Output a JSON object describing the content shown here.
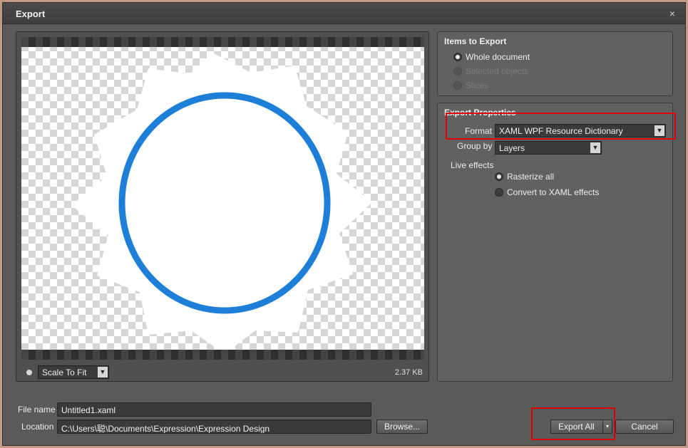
{
  "window": {
    "title": "Export",
    "close_glyph": "×"
  },
  "preview": {
    "zoom_value": "Scale To Fit",
    "file_size": "2.37 KB"
  },
  "items_to_export": {
    "title": "Items to Export",
    "options": [
      {
        "label": "Whole document",
        "checked": true,
        "enabled": true
      },
      {
        "label": "Selected objects",
        "checked": false,
        "enabled": false
      },
      {
        "label": "Slices",
        "checked": false,
        "enabled": false
      }
    ]
  },
  "export_properties": {
    "title": "Export Properties",
    "format_label": "Format",
    "format_value": "XAML WPF Resource Dictionary",
    "group_by_label": "Group by",
    "group_by_value": "Layers",
    "live_effects_label": "Live effects",
    "live_effects_options": [
      {
        "label": "Rasterize all",
        "checked": true
      },
      {
        "label": "Convert to XAML effects",
        "checked": false
      }
    ]
  },
  "file": {
    "name_label": "File name",
    "name_value": "Untitled1.xaml",
    "location_label": "Location",
    "location_value": "C:\\Users\\聪\\Documents\\Expression\\Expression Design",
    "browse_label": "Browse..."
  },
  "actions": {
    "export_all_label": "Export All",
    "export_all_arrow": "▾",
    "cancel_label": "Cancel"
  },
  "icons": {
    "dropdown_arrow": "▼"
  },
  "colors": {
    "ring": "#1e7fd8",
    "highlight": "#e00000"
  }
}
